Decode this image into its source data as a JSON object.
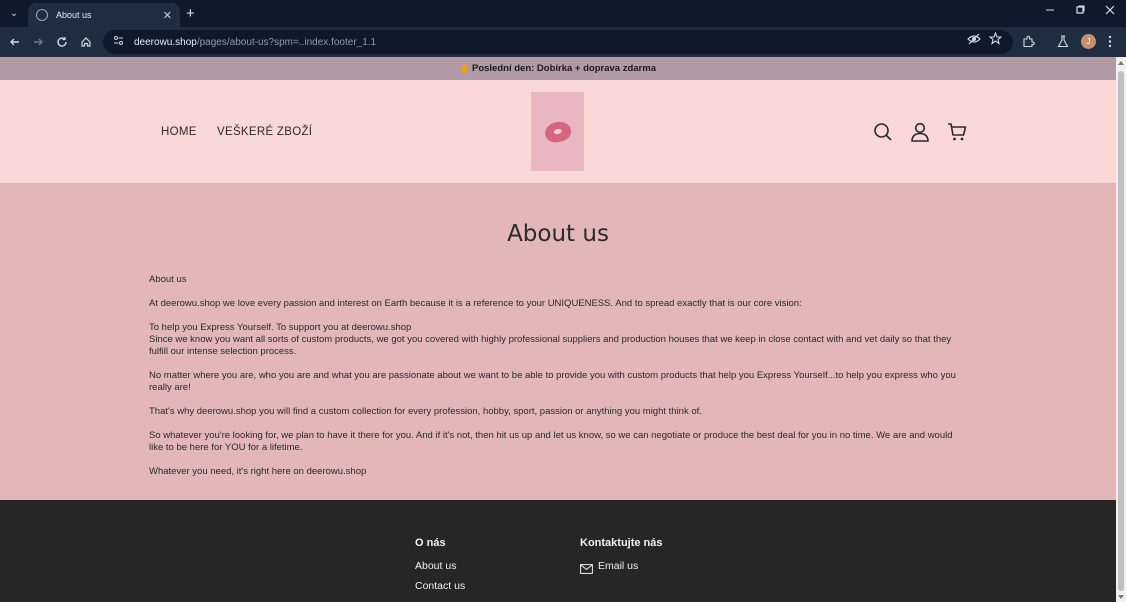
{
  "browser": {
    "tab_title": "About us",
    "close_glyph": "✕",
    "new_tab_glyph": "+",
    "menu_glyph": "⌄",
    "url_host": "deerowu.shop",
    "url_path": "/pages/about-us?spm=..index.footer_1.1",
    "avatar_letter": "J",
    "icons": [
      "chevron-down-icon",
      "globe-icon",
      "close-icon",
      "plus-icon",
      "back-arrow-icon",
      "forward-arrow-icon",
      "reload-icon",
      "home-icon",
      "site-info-icon",
      "eye-off-icon",
      "star-icon",
      "extensions-icon",
      "labs-icon",
      "kebab-menu-icon",
      "minimize-icon",
      "restore-icon",
      "close-window-icon"
    ]
  },
  "announcement": {
    "text": "Poslední den: Dobírka + doprava zdarma"
  },
  "header": {
    "nav": [
      "HOME",
      "VEŠKERÉ ZBOŽÍ"
    ],
    "icons": [
      "search-icon",
      "account-icon",
      "cart-icon"
    ]
  },
  "main": {
    "title": "About us",
    "paragraphs": [
      "About us",
      "At deerowu.shop we love every passion and interest on Earth because it is a reference to your UNIQUENESS. And to spread exactly that is our core vision:",
      "To help you Express Yourself. To support you at deerowu.shop",
      "Since we know you want all sorts of custom products, we got you covered with highly professional suppliers and production houses that we keep in close contact with and vet daily so that they fulfill our intense selection process.",
      "No matter where you are, who you are and what you are passionate about we want to be able to provide you with custom products that help you Express Yourself...to help you express who you really are!",
      "That's why deerowu.shop you will find a custom collection for every profession, hobby, sport, passion or anything you might think of.",
      "So whatever you're looking for, we plan to have it there for you. And if it's not, then hit us up and let us know, so we can negotiate or produce the best deal for you in no time. We are and would like to be here for YOU for a lifetime.",
      "Whatever you need, it's right here on deerowu.shop"
    ]
  },
  "footer": {
    "col1_heading": "O nás",
    "col1_links": [
      "About us",
      "Contact us"
    ],
    "col2_heading": "Kontaktujte nás",
    "email_label": "Email us"
  },
  "colors": {
    "announce_bg": "#b09aa4",
    "header_bg": "#fbd8d8",
    "main_bg": "#e3b6b8",
    "footer_bg": "#262626"
  }
}
